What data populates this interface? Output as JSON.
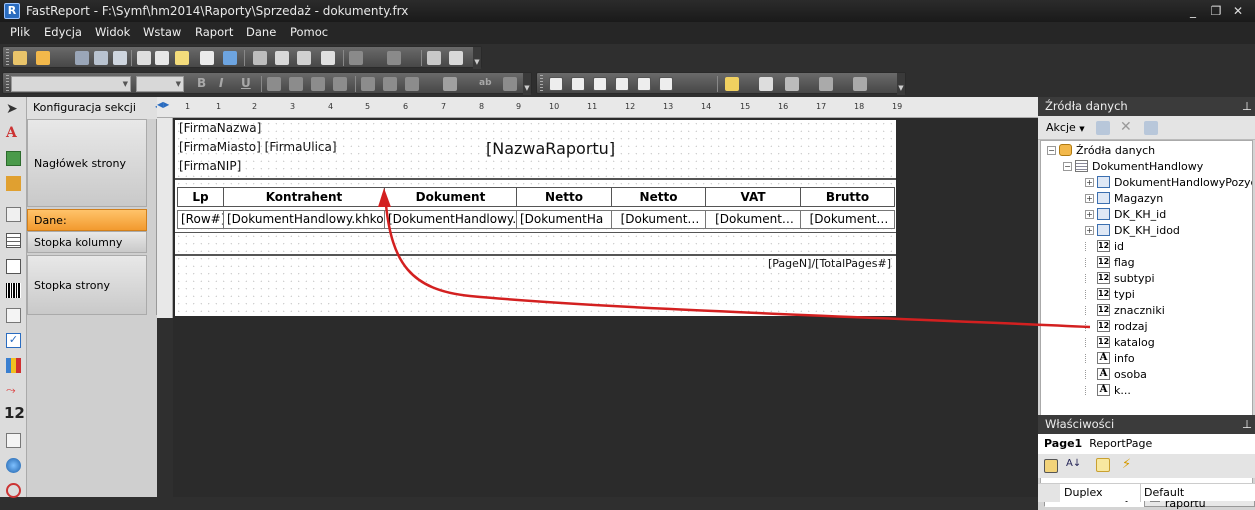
{
  "window": {
    "title": "FastReport - F:\\Symf\\hm2014\\Raporty\\Sprzedaż - dokumenty.frx",
    "app_icon_letter": "R",
    "minimize": "_",
    "restore": "❐",
    "close": "✕"
  },
  "menu": [
    "Plik",
    "Edycja",
    "Widok",
    "Wstaw",
    "Raport",
    "Dane",
    "Pomoc"
  ],
  "format_toolbar": {
    "bold": "B",
    "italic": "I",
    "underline": "U",
    "text_tool": "ab"
  },
  "sections": {
    "header_label": "Konfiguracja sekcji",
    "items": [
      {
        "label": "Nagłówek strony",
        "active": false
      },
      {
        "label": "Dane:",
        "active": true
      },
      {
        "label": "Stopka kolumny",
        "active": false
      },
      {
        "label": "Stopka strony",
        "active": false
      }
    ]
  },
  "ruler": {
    "numbers": [
      "1",
      "1",
      "2",
      "3",
      "4",
      "5",
      "6",
      "7",
      "8",
      "9",
      "10",
      "11",
      "12",
      "13",
      "14",
      "15",
      "16",
      "17",
      "18",
      "19"
    ]
  },
  "report": {
    "page_header": {
      "company_name": "[FirmaNazwa]",
      "company_city_street": "[FirmaMiasto] [FirmaUlica]",
      "company_nip": "[FirmaNIP]",
      "report_name": "[NazwaRaportu]"
    },
    "column_headers": [
      "Lp",
      "Kontrahent",
      "Dokument",
      "Netto",
      "Netto",
      "VAT",
      "Brutto"
    ],
    "data_row": [
      "[Row#]",
      "[DokumentHandlowy.khkod]",
      "[DokumentHandlowy.",
      "[DokumentHa",
      "[Dokument…",
      "[Dokument…",
      "[Dokument…"
    ],
    "page_footer": "[PageN]/[TotalPages#]"
  },
  "data_sources_panel": {
    "title": "Źródła danych",
    "pin": "⊥",
    "actions_label": "Akcje",
    "tree": [
      {
        "label": "Źródła danych",
        "level": 0,
        "icon": "database-icon",
        "expander": "−"
      },
      {
        "label": "DokumentHandlowy",
        "level": 1,
        "icon": "table-icon",
        "expander": "−"
      },
      {
        "label": "DokumentHandlowyPozycje",
        "level": 2,
        "icon": "relation-icon",
        "expander": "+"
      },
      {
        "label": "Magazyn",
        "level": 2,
        "icon": "relation-icon",
        "expander": "+"
      },
      {
        "label": "DK_KH_id",
        "level": 2,
        "icon": "relation-icon",
        "expander": "+"
      },
      {
        "label": "DK_KH_idod",
        "level": 2,
        "icon": "relation-icon",
        "expander": "+"
      },
      {
        "label": "id",
        "level": 2,
        "icon": "numeric-field-icon",
        "expander": ""
      },
      {
        "label": "flag",
        "level": 2,
        "icon": "numeric-field-icon",
        "expander": ""
      },
      {
        "label": "subtypi",
        "level": 2,
        "icon": "numeric-field-icon",
        "expander": ""
      },
      {
        "label": "typi",
        "level": 2,
        "icon": "numeric-field-icon",
        "expander": ""
      },
      {
        "label": "znaczniki",
        "level": 2,
        "icon": "numeric-field-icon",
        "expander": ""
      },
      {
        "label": "rodzaj",
        "level": 2,
        "icon": "numeric-field-icon",
        "expander": ""
      },
      {
        "label": "katalog",
        "level": 2,
        "icon": "numeric-field-icon",
        "expander": ""
      },
      {
        "label": "info",
        "level": 2,
        "icon": "text-field-icon",
        "expander": ""
      },
      {
        "label": "osoba",
        "level": 2,
        "icon": "text-field-icon",
        "expander": ""
      },
      {
        "label": "k...",
        "level": 2,
        "icon": "text-field-icon",
        "expander": ""
      }
    ],
    "numeric_icon_text": "12",
    "text_icon_text": "A",
    "tabs": [
      "Źródła danych",
      "Drzewo raportu"
    ]
  },
  "properties_panel": {
    "title": "Właściwości",
    "pin": "⊥",
    "object_name": "Page1",
    "object_type": "ReportPage",
    "az_sort": "A↓",
    "rows": [
      {
        "name": "Duplex",
        "value": "Default"
      }
    ]
  },
  "annotation": {
    "color": "#d32020"
  },
  "colors": {
    "active_section": "#f29a2e",
    "selected_node": "#3399ff"
  }
}
